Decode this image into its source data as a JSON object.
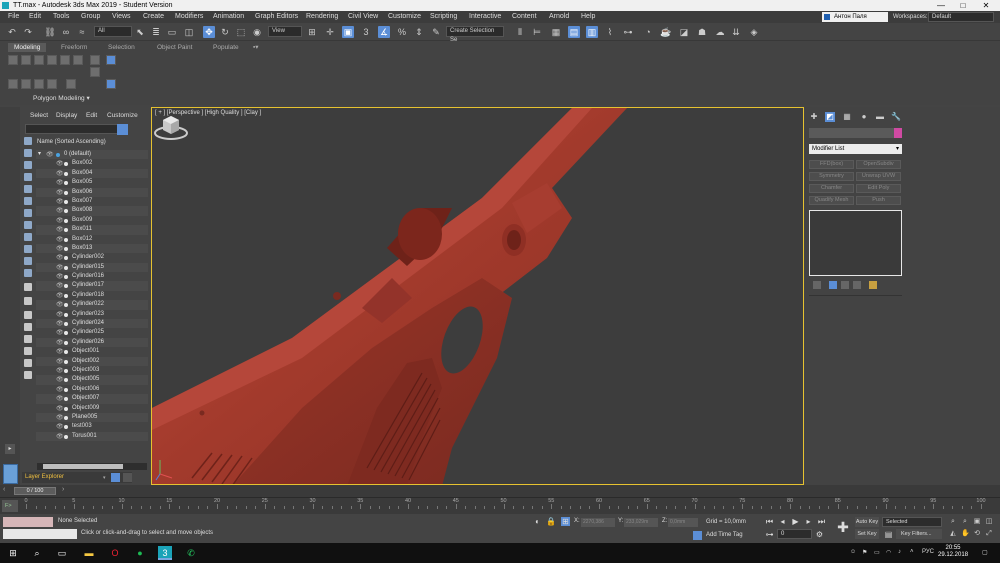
{
  "window": {
    "title": "TT.max - Autodesk 3ds Max 2019 - Student Version",
    "controls": [
      "—",
      "□",
      "✕"
    ]
  },
  "menubar": {
    "items": [
      "File",
      "Edit",
      "Tools",
      "Group",
      "Views",
      "Create",
      "Modifiers",
      "Animation",
      "Graph Editors",
      "Rendering",
      "Civil View",
      "Customize",
      "Scripting",
      "Interactive",
      "Content",
      "Arnold",
      "Help"
    ],
    "user": "Антон Паля",
    "workspaces_label": "Workspaces:",
    "workspace": "Default"
  },
  "toolbar": {
    "filter": "All",
    "refcoord": "View",
    "selection_set": "Create Selection Se"
  },
  "ribbon": {
    "tabs": [
      "Modeling",
      "Freeform",
      "Selection",
      "Object Paint",
      "Populate"
    ],
    "panel_label": "Polygon Modeling ▾"
  },
  "explorer": {
    "tabs": [
      "Select",
      "Display",
      "Edit",
      "Customize"
    ],
    "header": "Name (Sorted Ascending)",
    "layer": "0 (default)",
    "objects": [
      "Box002",
      "Box004",
      "Box005",
      "Box006",
      "Box007",
      "Box008",
      "Box009",
      "Box011",
      "Box012",
      "Box013",
      "Cylinder002",
      "Cylinder015",
      "Cylinder016",
      "Cylinder017",
      "Cylinder018",
      "Cylinder022",
      "Cylinder023",
      "Cylinder024",
      "Cylinder025",
      "Cylinder026",
      "Object001",
      "Object002",
      "Object003",
      "Object005",
      "Object006",
      "Object007",
      "Object009",
      "Plane005",
      "test003",
      "Torus001"
    ],
    "layer_explorer": "Layer Explorer"
  },
  "viewport": {
    "label": "[ + ] [Perspective ] [High Quality ] [Clay ]",
    "colors": {
      "model": "#a23a2c",
      "model_dark": "#7a2a20",
      "model_light": "#c24a3a",
      "border": "#e6c230"
    }
  },
  "command_panel": {
    "modifier_list": "Modifier List",
    "buttons": [
      "FFD(box)",
      "OpenSubdiv",
      "Symmetry",
      "Unwrap UVW",
      "Chamfer",
      "Edit Poly",
      "Quadify Mesh",
      "Push"
    ]
  },
  "timeline": {
    "slider": "0 / 100",
    "ticks": [
      "0",
      "5",
      "10",
      "15",
      "20",
      "25",
      "30",
      "35",
      "40",
      "45",
      "50",
      "55",
      "60",
      "65",
      "70",
      "75",
      "80",
      "85",
      "90",
      "95",
      "100"
    ]
  },
  "status": {
    "selection": "None Selected",
    "prompt": "Click or click-and-drag to select and move objects",
    "x_label": "X:",
    "x_value": "2270,386",
    "y_label": "Y:",
    "y_value": "233,029m",
    "z_label": "Z:",
    "z_value": "0,0mm",
    "grid": "Grid = 10,0mm",
    "add_time_tag": "Add Time Tag",
    "frame": "0",
    "auto_key": "Auto Key",
    "set_key": "Set Key",
    "key_mode": "Selected",
    "key_filters": "Key Filters..."
  },
  "taskbar": {
    "lang": "РУС",
    "time": "20:55",
    "date": "29.12.2018"
  }
}
